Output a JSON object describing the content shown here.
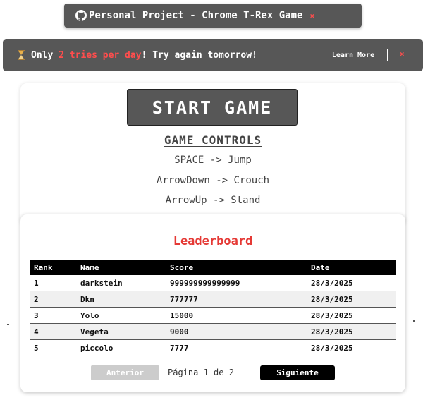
{
  "github_banner": {
    "text": "Personal Project - Chrome T-Rex Game",
    "close": "×"
  },
  "limit_banner": {
    "prefix": "Only ",
    "highlight": "2 tries per day",
    "suffix": "! Try again tomorrow!",
    "learn_more": "Learn More",
    "close": "×",
    "accent_color": "#ff4d4d"
  },
  "game": {
    "start_label": "START GAME",
    "controls_title": "GAME CONTROLS",
    "controls": [
      "SPACE -> Jump",
      "ArrowDown -> Crouch",
      "ArrowUp -> Stand"
    ]
  },
  "leaderboard": {
    "title": "Leaderboard",
    "title_color": "#e53935",
    "columns": [
      "Rank",
      "Name",
      "Score",
      "Date"
    ],
    "rows": [
      {
        "rank": "1",
        "name": "darkstein",
        "score": "999999999999999",
        "date": "28/3/2025"
      },
      {
        "rank": "2",
        "name": "Dkn",
        "score": "777777",
        "date": "28/3/2025"
      },
      {
        "rank": "3",
        "name": "Yolo",
        "score": "15000",
        "date": "28/3/2025"
      },
      {
        "rank": "4",
        "name": "Vegeta",
        "score": "9000",
        "date": "28/3/2025"
      },
      {
        "rank": "5",
        "name": "piccolo",
        "score": "7777",
        "date": "28/3/2025"
      }
    ],
    "pagination": {
      "prev": "Anterior",
      "info": "Página 1 de 2",
      "next": "Siguiente"
    }
  }
}
